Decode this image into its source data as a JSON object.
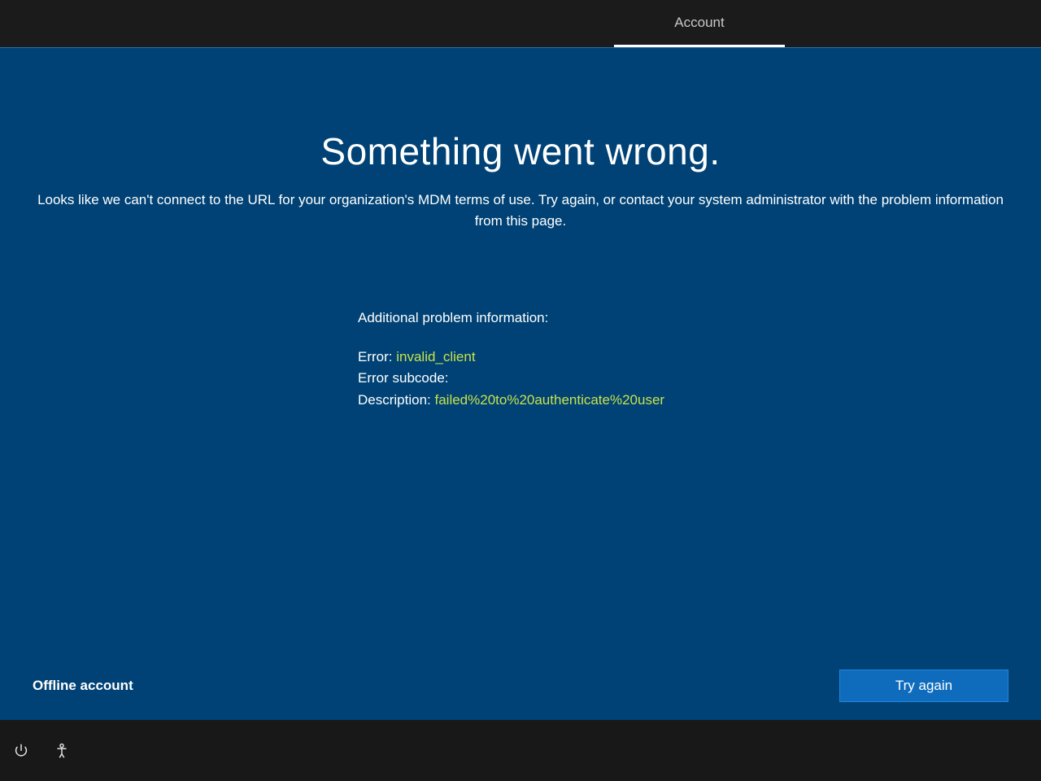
{
  "tab": {
    "label": "Account"
  },
  "error": {
    "title": "Something went wrong.",
    "subtitle": "Looks like we can't connect to the URL for your organization's MDM terms of use. Try again, or contact your system administrator with the problem information from this page.",
    "info_heading": "Additional problem information:",
    "error_label": "Error: ",
    "error_value": "invalid_client",
    "subcode_label": "Error subcode:",
    "subcode_value": "",
    "description_label": "Description: ",
    "description_value": "failed%20to%20authenticate%20user"
  },
  "actions": {
    "offline_label": "Offline account",
    "try_again_label": "Try again"
  }
}
